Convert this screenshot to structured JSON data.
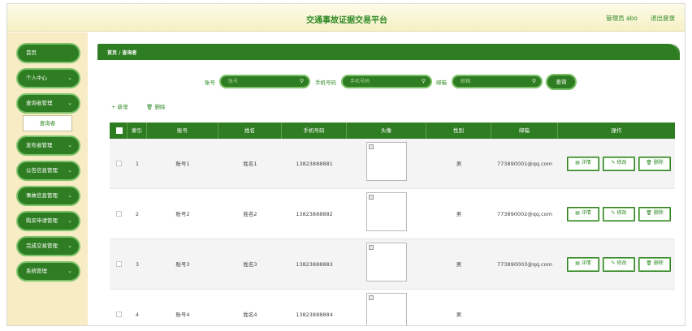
{
  "header": {
    "title": "交通事故证据交易平台",
    "user": "管理员 abo",
    "logout": "退出登录"
  },
  "sidebar": {
    "items": [
      {
        "label": "首页",
        "chevron": false
      },
      {
        "label": "个人中心",
        "chevron": true
      },
      {
        "label": "查询者管理",
        "chevron": true
      },
      {
        "label": "发布者管理",
        "chevron": true
      },
      {
        "label": "公告信息管理",
        "chevron": true
      },
      {
        "label": "事故信息管理",
        "chevron": true
      },
      {
        "label": "购买申请管理",
        "chevron": true
      },
      {
        "label": "完成交易管理",
        "chevron": true
      },
      {
        "label": "系统管理",
        "chevron": true
      }
    ],
    "subitem": "查询者"
  },
  "breadcrumb": "首页 / 查询者",
  "search": {
    "account_label": "账号",
    "account_placeholder": "账号",
    "phone_label": "手机号码",
    "phone_placeholder": "手机号码",
    "email_label": "邮箱",
    "email_placeholder": "邮箱",
    "button": "查询"
  },
  "actions": {
    "add": "+ 新增",
    "delete": "删除"
  },
  "table": {
    "headers": [
      "",
      "索引",
      "账号",
      "姓名",
      "手机号码",
      "头像",
      "性别",
      "邮箱",
      "操作"
    ],
    "rows": [
      {
        "index": "1",
        "account": "账号1",
        "name": "姓名1",
        "phone": "13823888881",
        "gender": "男",
        "email": "773890001@qq.com"
      },
      {
        "index": "2",
        "account": "账号2",
        "name": "姓名2",
        "phone": "13823888882",
        "gender": "男",
        "email": "773890002@qq.com"
      },
      {
        "index": "3",
        "account": "账号3",
        "name": "姓名3",
        "phone": "13823888883",
        "gender": "男",
        "email": "773890003@qq.com"
      },
      {
        "index": "4",
        "account": "账号4",
        "name": "姓名4",
        "phone": "13823888884",
        "gender": "男",
        "email": ""
      }
    ],
    "ops": {
      "detail": "详情",
      "edit": "修改",
      "delete": "删除"
    }
  },
  "icons": {
    "search": "search-icon",
    "chevron": "chevron-down-icon",
    "image": "broken-image-icon",
    "detail": "document-icon",
    "edit": "pencil-icon",
    "trash": "trash-icon"
  },
  "colors": {
    "primary": "#2f7d22",
    "accent": "#7cc26a",
    "sidebar_bg": "#f7ecc4",
    "text_green": "#2f8a25"
  }
}
